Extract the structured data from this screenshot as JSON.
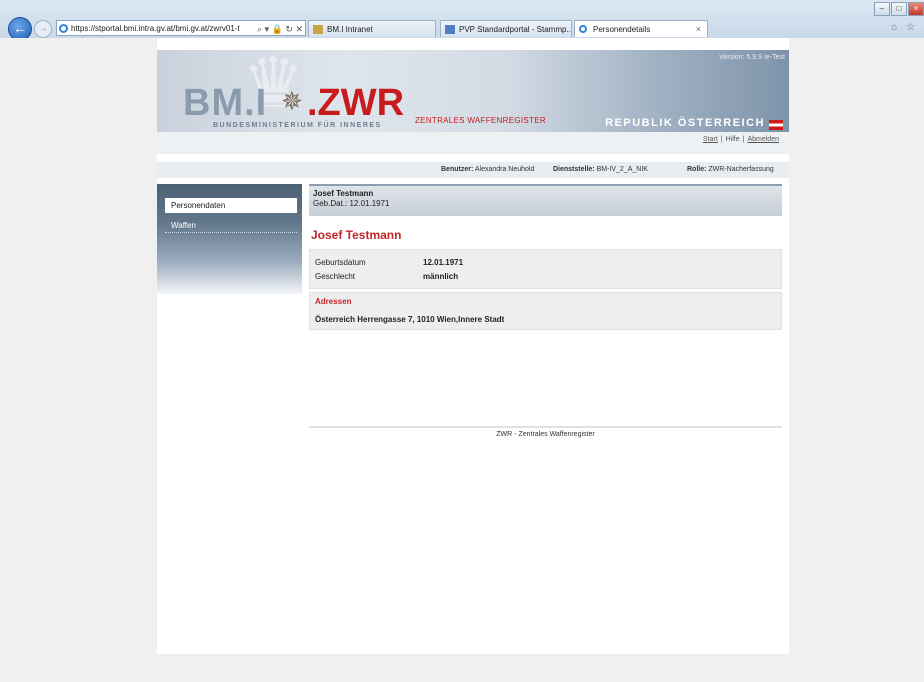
{
  "browser": {
    "url": "https://stportal.bmi.intra.gv.at/bmi.gv.at/zwrv01-t",
    "tabs": [
      {
        "label": "BM.I Intranet",
        "active": false
      },
      {
        "label": "PVP Standardportal - Stammp...",
        "active": false
      },
      {
        "label": "Personendetails",
        "active": true
      }
    ],
    "back_glyph": "←",
    "fwd_glyph": "→",
    "addr_tools": "⌕ ▾ 🔒 ↻ ✕",
    "window_controls": [
      "–",
      "□",
      "×"
    ],
    "right_icons": "⌂ ☆"
  },
  "banner": {
    "version": "Version: 5.9.9 Ie-Test",
    "logo_left": "BM.I",
    "logo_star": "✵",
    "logo_right": ".ZWR",
    "logo_sub": "ZENTRALES WAFFENREGISTER",
    "ministry": "BUNDESMINISTERIUM FÜR INNERES",
    "republik": "REPUBLIK ÖSTERREICH"
  },
  "toplinks": {
    "start": "Start",
    "hilfe": "Hilfe",
    "abmelden": "Abmelden",
    "sep": "|"
  },
  "userbar": {
    "benutzer_label": "Benutzer:",
    "benutzer_value": "Alexandra Neuhold",
    "dienststelle_label": "Dienststelle:",
    "dienststelle_value": "BM-IV_2_A_NIK",
    "rolle_label": "Rolle:",
    "rolle_value": "ZWR-Nacherfassung"
  },
  "nav": {
    "items": [
      {
        "label": "Personendaten",
        "active": true
      },
      {
        "label": "Waffen",
        "active": false
      }
    ]
  },
  "person": {
    "header_name": "Josef Testmann",
    "header_date": "Geb.Dat.: 12.01.1971",
    "title": "Josef Testmann",
    "geburtsdatum_label": "Geburtsdatum",
    "geburtsdatum_value": "12.01.1971",
    "geschlecht_label": "Geschlecht",
    "geschlecht_value": "männlich"
  },
  "addresses": {
    "title": "Adressen",
    "line": "Österreich  Herrengasse 7, 1010 Wien,Innere Stadt"
  },
  "footer": "ZWR - Zentrales Waffenregister",
  "colors": {
    "accent_red": "#c0262b",
    "banner_gray": "#8b9bad"
  }
}
